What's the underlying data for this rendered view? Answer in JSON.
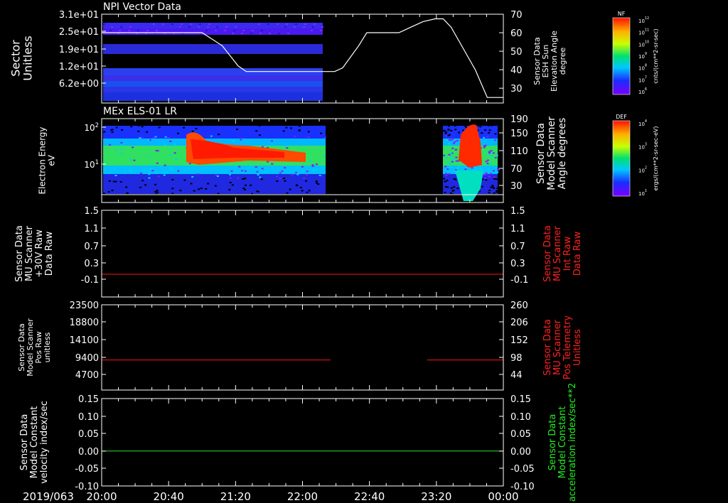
{
  "footer": {
    "date_label": "2019/063",
    "time_ticks": [
      "20:00",
      "20:40",
      "21:20",
      "22:00",
      "22:40",
      "23:20",
      "00:00"
    ]
  },
  "chart_data": [
    {
      "type": "heatmap",
      "title": "NPI Vector Data",
      "ylabel": "Sector Unitless",
      "yticks": [
        "3.1e+01",
        "2.5e+01",
        "1.9e+01",
        "1.2e+01",
        "6.2e+00"
      ],
      "overlay_line": {
        "ylabel": "Sensor Data ESH Sun Elevation Angle degree",
        "yticks": [
          "70",
          "60",
          "50",
          "40",
          "30"
        ],
        "ylim": [
          22,
          70
        ],
        "points": [
          [
            0,
            60
          ],
          [
            0.1,
            60
          ],
          [
            0.25,
            60
          ],
          [
            0.3,
            53
          ],
          [
            0.34,
            42
          ],
          [
            0.36,
            39
          ],
          [
            0.45,
            39
          ],
          [
            0.56,
            39
          ],
          [
            0.58,
            39
          ],
          [
            0.6,
            41
          ],
          [
            0.64,
            53
          ],
          [
            0.66,
            60
          ],
          [
            0.74,
            60
          ],
          [
            0.77,
            63
          ],
          [
            0.8,
            66
          ],
          [
            0.83,
            67.5
          ],
          [
            0.85,
            67.5
          ],
          [
            0.87,
            63
          ],
          [
            0.93,
            40
          ],
          [
            0.96,
            25
          ],
          [
            1.0,
            25
          ]
        ]
      },
      "colorbar": {
        "label": "NF",
        "units": "cnts/(cm**2-sr-sec)",
        "ticks": [
          "10^12",
          "10^11",
          "10^10",
          "10^9",
          "10^8",
          "10^7",
          "10^6"
        ]
      }
    },
    {
      "type": "heatmap",
      "title": "MEx ELS-01 LR",
      "ylabel": "Electron Energy eV",
      "yticks": [
        "10^2",
        "10^1"
      ],
      "right_axis": {
        "ylabel": "Sensor Data Model Scanner Angle degrees",
        "yticks": [
          "190",
          "150",
          "110",
          "70",
          "30"
        ]
      },
      "colorbar": {
        "label": "DEF",
        "units": "ergs/(cm**2-sr-sec-eV)",
        "ticks": [
          "10^4",
          "10^3",
          "10^2",
          "10^1"
        ]
      }
    },
    {
      "type": "line",
      "ylabel": "Sensor Data MU Scanner +30V Raw Data Raw",
      "yticks": [
        "1.5",
        "1.1",
        "0.7",
        "0.3",
        "-0.1"
      ],
      "ylim": [
        -0.45,
        1.5
      ],
      "right_axis": {
        "ylabel": "Sensor Data MU Scanner Int Raw Data Raw",
        "yticks": [
          "1.5",
          "1.1",
          "0.7",
          "0.3",
          "-0.1"
        ],
        "color": "#ff2020"
      },
      "series": [
        {
          "color": "#d01010",
          "segments": [
            [
              [
                0,
                0
              ],
              [
                1,
                0
              ]
            ]
          ]
        }
      ]
    },
    {
      "type": "line",
      "ylabel": "Sensor Data Model Scanner Pos Raw unitless",
      "yticks": [
        "23500",
        "18800",
        "14100",
        "9400",
        "4700"
      ],
      "ylim": [
        0,
        23500
      ],
      "right_axis": {
        "ylabel": "Sensor Data MU Scanner Pos Telemetry Unitless",
        "yticks": [
          "260",
          "206",
          "152",
          "98",
          "44"
        ],
        "color": "#ff2020"
      },
      "series": [
        {
          "color": "#d01010",
          "segments": [
            [
              [
                0,
                8300
              ],
              [
                0.57,
                8300
              ]
            ],
            [
              [
                0.81,
                8300
              ],
              [
                1,
                8300
              ]
            ]
          ]
        }
      ]
    },
    {
      "type": "line",
      "ylabel": "Sensor Data Model Constant velocity index/sec",
      "yticks": [
        "0.15",
        "0.10",
        "0.05",
        "0.00",
        "-0.05",
        "-0.10"
      ],
      "ylim": [
        -0.1,
        0.15
      ],
      "right_axis": {
        "ylabel": "Sensor Data Model Constant acceleration index/sec**2",
        "yticks": [
          "0.15",
          "0.10",
          "0.05",
          "0.00",
          "-0.05",
          "-0.10"
        ],
        "color": "#22ee22"
      },
      "series": [
        {
          "color": "#22cc22",
          "segments": [
            [
              [
                0,
                0
              ],
              [
                1,
                0
              ]
            ]
          ]
        }
      ]
    }
  ]
}
